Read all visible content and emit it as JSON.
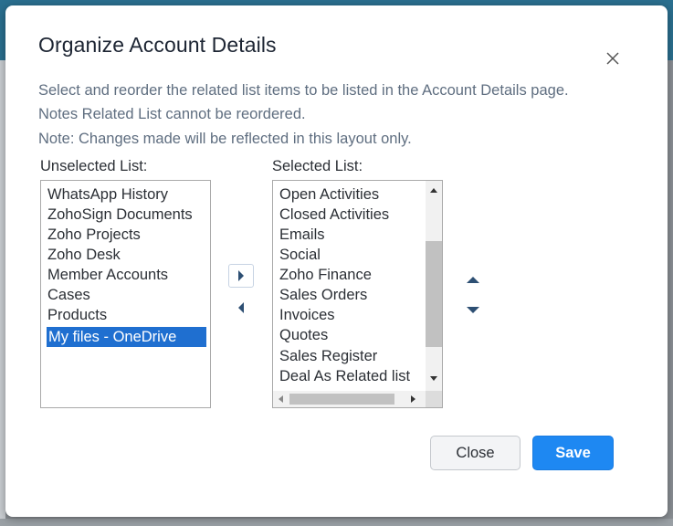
{
  "dialog": {
    "title": "Organize Account Details",
    "description": [
      "Select and reorder the related list items to be listed in the Account Details page.",
      "Notes Related List cannot be reordered.",
      "Note: Changes made will be reflected in this layout only."
    ]
  },
  "unselected": {
    "label": "Unselected List:",
    "items": [
      "WhatsApp History",
      "ZohoSign Documents",
      "Zoho Projects",
      "Zoho Desk",
      "Member Accounts",
      "Cases",
      "Products",
      "My files - OneDrive"
    ],
    "selected_item": "My files - OneDrive"
  },
  "selected": {
    "label": "Selected List:",
    "items": [
      "Open Activities",
      "Closed Activities",
      "Emails",
      "Social",
      "Zoho Finance",
      "Sales Orders",
      "Invoices",
      "Quotes",
      "Sales Register",
      "Deal As Related list"
    ]
  },
  "icons": {
    "close": "close-icon",
    "move_right": "caret-right-icon",
    "move_left": "caret-left-icon",
    "move_up": "caret-up-icon",
    "move_down": "caret-down-icon"
  },
  "buttons": {
    "close_label": "Close",
    "save_label": "Save"
  },
  "colors": {
    "accent": "#1e88f2",
    "selection": "#1f6fd0",
    "arrow": "#2d4f73"
  }
}
